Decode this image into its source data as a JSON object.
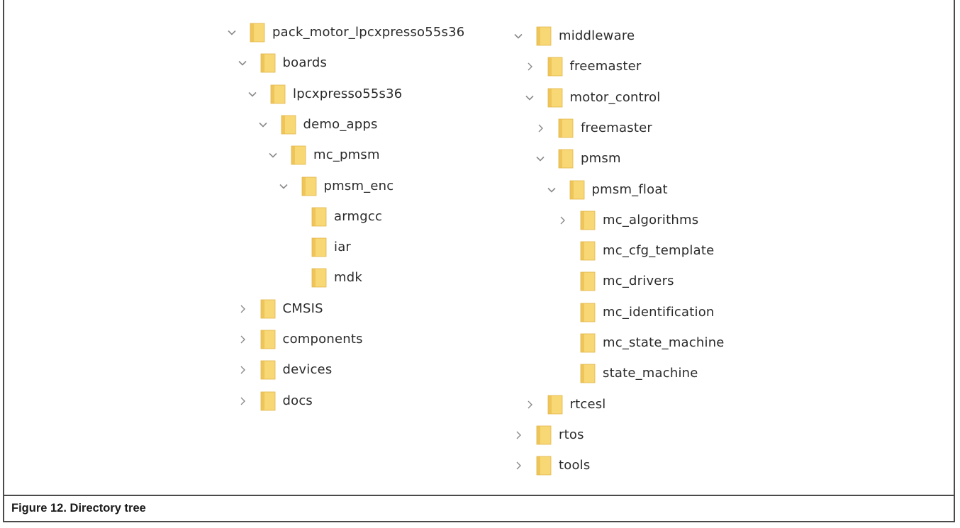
{
  "caption": "Figure 12. Directory tree",
  "icons": {
    "folder": "folder-icon",
    "expanded": "chevron-down-icon",
    "collapsed": "chevron-right-icon"
  },
  "colors": {
    "folder_fill": "#F8D775",
    "folder_shade": "#EFC55A",
    "chevron": "#8a8a8a",
    "text": "#2b2b2b"
  },
  "tree_left": [
    {
      "label": "pack_motor_lpcxpresso55s36",
      "depth": 0,
      "chevron": "expanded"
    },
    {
      "label": "boards",
      "depth": 1,
      "chevron": "expanded"
    },
    {
      "label": "lpcxpresso55s36",
      "depth": 2,
      "chevron": "expanded"
    },
    {
      "label": "demo_apps",
      "depth": 3,
      "chevron": "expanded"
    },
    {
      "label": "mc_pmsm",
      "depth": 4,
      "chevron": "expanded"
    },
    {
      "label": "pmsm_enc",
      "depth": 5,
      "chevron": "expanded"
    },
    {
      "label": "armgcc",
      "depth": 6,
      "chevron": "none"
    },
    {
      "label": "iar",
      "depth": 6,
      "chevron": "none"
    },
    {
      "label": "mdk",
      "depth": 6,
      "chevron": "none"
    },
    {
      "label": "CMSIS",
      "depth": 1,
      "chevron": "collapsed"
    },
    {
      "label": "components",
      "depth": 1,
      "chevron": "collapsed"
    },
    {
      "label": "devices",
      "depth": 1,
      "chevron": "collapsed"
    },
    {
      "label": "docs",
      "depth": 1,
      "chevron": "collapsed"
    }
  ],
  "tree_right": [
    {
      "label": "middleware",
      "depth": 0,
      "chevron": "expanded"
    },
    {
      "label": "freemaster",
      "depth": 1,
      "chevron": "collapsed"
    },
    {
      "label": "motor_control",
      "depth": 1,
      "chevron": "expanded"
    },
    {
      "label": "freemaster",
      "depth": 2,
      "chevron": "collapsed"
    },
    {
      "label": "pmsm",
      "depth": 2,
      "chevron": "expanded"
    },
    {
      "label": "pmsm_float",
      "depth": 3,
      "chevron": "expanded"
    },
    {
      "label": "mc_algorithms",
      "depth": 4,
      "chevron": "collapsed"
    },
    {
      "label": "mc_cfg_template",
      "depth": 4,
      "chevron": "none"
    },
    {
      "label": "mc_drivers",
      "depth": 4,
      "chevron": "none"
    },
    {
      "label": "mc_identification",
      "depth": 4,
      "chevron": "none"
    },
    {
      "label": "mc_state_machine",
      "depth": 4,
      "chevron": "none"
    },
    {
      "label": "state_machine",
      "depth": 4,
      "chevron": "none"
    },
    {
      "label": "rtcesl",
      "depth": 1,
      "chevron": "collapsed"
    },
    {
      "label": "rtos",
      "depth": 0,
      "chevron": "collapsed"
    },
    {
      "label": "tools",
      "depth": 0,
      "chevron": "collapsed"
    }
  ]
}
